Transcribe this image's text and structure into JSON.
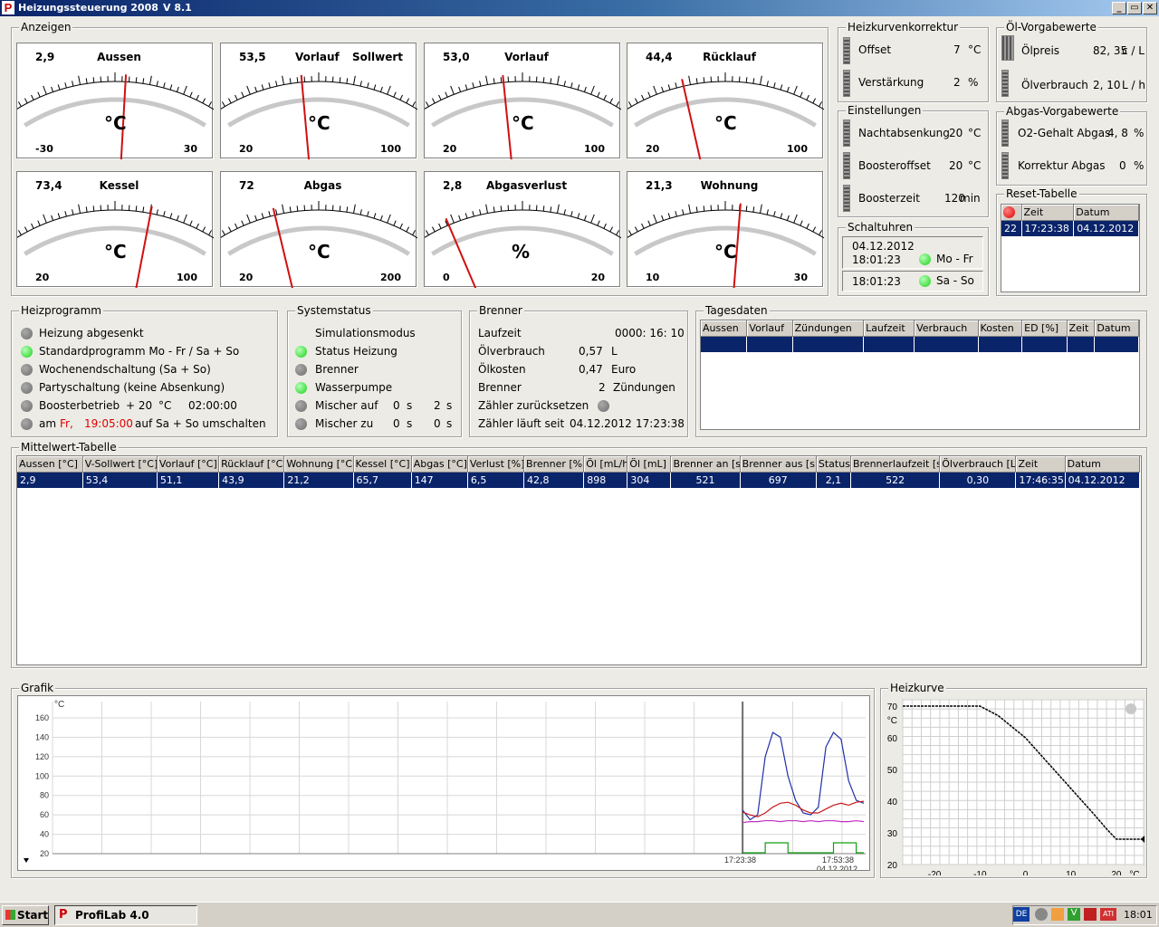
{
  "window": {
    "title": "Heizungssteuerung 2008",
    "version": "V 8.1",
    "btn_min": "_",
    "btn_max": "▭",
    "btn_close": "✕"
  },
  "anzeigen": {
    "caption": "Anzeigen",
    "gauges": [
      {
        "value": "2,9",
        "name": "Aussen",
        "unit": "°C",
        "min": "-30",
        "max": "30",
        "fraction": 0.55
      },
      {
        "value": "53,5",
        "name": "Vorlauf",
        "name2": "Sollwert",
        "unit": "°C",
        "min": "20",
        "max": "100",
        "fraction": 0.42
      },
      {
        "value": "53,0",
        "name": "Vorlauf",
        "unit": "°C",
        "min": "20",
        "max": "100",
        "fraction": 0.41
      },
      {
        "value": "44,4",
        "name": "Rücklauf",
        "unit": "°C",
        "min": "20",
        "max": "100",
        "fraction": 0.3
      },
      {
        "value": "73,4",
        "name": "Kessel",
        "unit": "°C",
        "min": "20",
        "max": "100",
        "fraction": 0.67
      },
      {
        "value": "72",
        "name": "Abgas",
        "unit": "°C",
        "min": "20",
        "max": "200",
        "fraction": 0.29
      },
      {
        "value": "2,8",
        "name": "Abgasverlust",
        "unit": "%",
        "min": "0",
        "max": "20",
        "fraction": 0.14
      },
      {
        "value": "21,3",
        "name": "Wohnung",
        "unit": "°C",
        "min": "10",
        "max": "30",
        "fraction": 0.57
      }
    ]
  },
  "heizkurvenkorrektur": {
    "caption": "Heizkurvenkorrektur",
    "offset_label": "Offset",
    "offset_value": "7",
    "offset_unit": "°C",
    "verstaerkung_label": "Verstärkung",
    "verstaerkung_value": "2",
    "verstaerkung_unit": "%"
  },
  "einstellungen": {
    "caption": "Einstellungen",
    "rows": [
      {
        "label": "Nachtabsenkung",
        "value": "20",
        "unit": "°C"
      },
      {
        "label": "Boosteroffset",
        "value": "20",
        "unit": "°C"
      },
      {
        "label": "Boosterzeit",
        "value": "120",
        "unit": "min"
      }
    ]
  },
  "schaltuhren": {
    "caption": "Schaltuhren",
    "date": "04.12.2012",
    "time1": "18:01:23",
    "label1": "Mo - Fr",
    "time2": "18:01:23",
    "label2": "Sa - So"
  },
  "oel": {
    "caption": "Öl-Vorgabewerte",
    "preis_label": "Ölpreis",
    "preis_value": "82, 35",
    "preis_unit": "c / L",
    "verbrauch_label": "Ölverbrauch",
    "verbrauch_value": "2, 10",
    "verbrauch_unit": "L / h"
  },
  "abgas": {
    "caption": "Abgas-Vorgabewerte",
    "o2_label": "O2-Gehalt Abgas",
    "o2_value": "4, 8",
    "o2_unit": "%",
    "korr_label": "Korrektur Abgas",
    "korr_value": "0",
    "korr_unit": "%"
  },
  "reset": {
    "caption": "Reset-Tabelle",
    "h_zeit": "Zeit",
    "h_datum": "Datum",
    "row_n": "22",
    "row_zeit": "17:23:38",
    "row_datum": "04.12.2012"
  },
  "heizprogramm": {
    "caption": "Heizprogramm",
    "items": [
      {
        "label": "Heizung abgesenkt",
        "on": false
      },
      {
        "label": "Standardprogramm Mo - Fr / Sa + So",
        "on": true
      },
      {
        "label": "Wochenendschaltung (Sa + So)",
        "on": false
      },
      {
        "label": "Partyschaltung (keine Absenkung)",
        "on": false
      }
    ],
    "booster_label": "Boosterbetrieb",
    "booster_plus": "+ 20",
    "booster_unit": "°C",
    "booster_time": "02:00:00",
    "am_label": "am",
    "am_day": "Fr,",
    "am_time": "19:05:00",
    "am_rest": "auf Sa + So umschalten"
  },
  "systemstatus": {
    "caption": "Systemstatus",
    "sim": "Simulationsmodus",
    "status": "Status Heizung",
    "brenner": "Brenner",
    "pumpe": "Wasserpumpe",
    "mischer_auf": "Mischer auf",
    "mischer_zu": "Mischer zu",
    "m1": "0",
    "m2": "2",
    "z1": "0",
    "z2": "0",
    "s": "s"
  },
  "brenner": {
    "caption": "Brenner",
    "laufzeit_label": "Laufzeit",
    "laufzeit": "0000: 16: 10",
    "oel_label": "Ölverbrauch",
    "oel_value": "0,57",
    "oel_unit": "L",
    "kosten_label": "Ölkosten",
    "kosten_value": "0,47",
    "kosten_unit": "Euro",
    "brenner_label": "Brenner",
    "brenner_value": "2",
    "brenner_unit": "Zündungen",
    "reset_label": "Zähler zurücksetzen",
    "seit_label": "Zähler läuft seit",
    "seit_date": "04.12.2012",
    "seit_time": "17:23:38"
  },
  "tagesdaten": {
    "caption": "Tagesdaten",
    "headers": [
      "Aussen",
      "Vorlauf",
      "Zündungen",
      "Laufzeit",
      "Verbrauch",
      "Kosten",
      "ED [%]",
      "Zeit",
      "Datum"
    ]
  },
  "mittelwert": {
    "caption": "Mittelwert-Tabelle",
    "headers": [
      "Aussen [°C]",
      "V-Sollwert [°C]",
      "Vorlauf [°C]",
      "Rücklauf [°C]",
      "Wohnung [°C]",
      "Kessel [°C]",
      "Abgas [°C]",
      "Verlust [%]",
      "Brenner [%]",
      "Öl [mL/h]",
      "Öl [mL]",
      "Brenner an [s]",
      "Brenner aus [s]",
      "Status",
      "Brennerlaufzeit [s]",
      "Ölverbrauch [L]",
      "Zeit",
      "Datum"
    ],
    "row": [
      "2,9",
      "53,4",
      "51,1",
      "43,9",
      "21,2",
      "65,7",
      "147",
      "6,5",
      "42,8",
      "898",
      "304",
      "521",
      "697",
      "2,1",
      "522",
      "0,30",
      "17:46:35",
      "04.12.2012"
    ]
  },
  "grafik": {
    "caption": "Grafik",
    "unit": "°C",
    "yticks": [
      "160",
      "140",
      "120",
      "100",
      "80",
      "60",
      "40",
      "20"
    ],
    "t_start": "17:23:38",
    "t_end": "17:53:38",
    "t_date": "04.12.2012"
  },
  "heizkurve": {
    "caption": "Heizkurve",
    "unit": "°C",
    "yticks": [
      "70",
      "60",
      "50",
      "40",
      "30",
      "20"
    ],
    "xticks": [
      "-20",
      "-10",
      "0",
      "10",
      "20"
    ],
    "xunit": "°C"
  },
  "chart_data": [
    {
      "type": "line",
      "title": "Grafik",
      "ylabel": "°C",
      "ylim": [
        20,
        165
      ],
      "x": [
        "17:23:38",
        "17:53:38"
      ],
      "series": [
        {
          "color": "#1f2fa8",
          "values": [
            65,
            55,
            60,
            120,
            145,
            140,
            100,
            75,
            62,
            60,
            68,
            130,
            145,
            138,
            95,
            75,
            72
          ]
        },
        {
          "color": "#c81a1a",
          "values": [
            63,
            60,
            58,
            62,
            68,
            72,
            73,
            70,
            65,
            62,
            62,
            66,
            70,
            72,
            70,
            73,
            74
          ]
        },
        {
          "color": "#c030c0",
          "values": [
            52,
            53,
            53,
            54,
            54,
            53,
            54,
            54,
            53,
            54,
            53,
            54,
            54,
            53,
            53,
            54,
            53
          ]
        },
        {
          "color": "#12a012",
          "values": [
            0,
            0,
            0,
            30,
            30,
            30,
            0,
            0,
            0,
            0,
            0,
            0,
            30,
            30,
            30,
            0,
            0
          ]
        }
      ]
    },
    {
      "type": "line",
      "title": "Heizkurve",
      "xlabel": "°C",
      "ylabel": "°C",
      "xlim": [
        -27,
        26
      ],
      "ylim": [
        20,
        72
      ],
      "x": [
        -27,
        -10,
        -6,
        0,
        5,
        10,
        15,
        18,
        20,
        26
      ],
      "y": [
        70,
        70,
        67,
        60,
        52,
        44,
        36,
        31,
        28,
        28
      ]
    }
  ]
}
